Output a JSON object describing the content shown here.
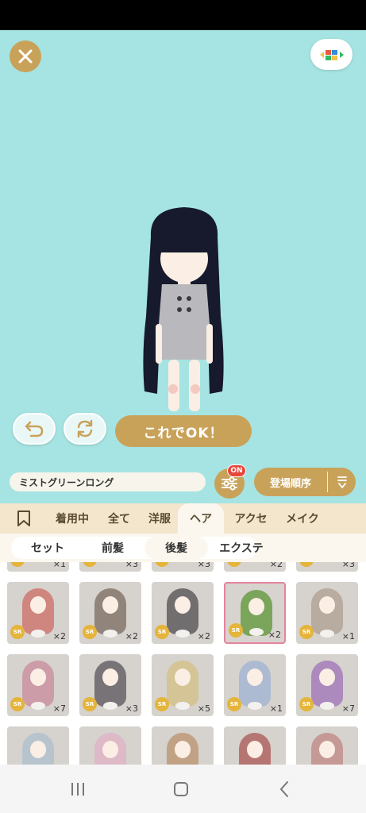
{
  "stage": {
    "ok_label": "これでOK！"
  },
  "namebar": {
    "item_name": "ミストグリーンロング",
    "filter_badge": "ON",
    "sort_label": "登場順序"
  },
  "tabs": [
    {
      "label": "",
      "icon": "bookmark-icon"
    },
    {
      "label": "着用中"
    },
    {
      "label": "全て"
    },
    {
      "label": "洋服"
    },
    {
      "label": "ヘア",
      "active": true
    },
    {
      "label": "アクセ"
    },
    {
      "label": "メイク"
    }
  ],
  "subtabs": [
    {
      "label": "セット"
    },
    {
      "label": "前髪"
    },
    {
      "label": "後髪",
      "active": true
    },
    {
      "label": "エクステ"
    }
  ],
  "grid": {
    "partial_row": [
      "×1",
      "×3",
      "×3",
      "×2",
      "×3"
    ],
    "row1": [
      {
        "rarity": "SR",
        "count": "×2",
        "color": "#c8473f"
      },
      {
        "rarity": "SR",
        "count": "×2",
        "color": "#5a4638"
      },
      {
        "rarity": "SR",
        "count": "×2",
        "color": "#1f1c24"
      },
      {
        "rarity": "SR",
        "count": "×2",
        "color": "#7aa55a",
        "selected": true
      },
      {
        "rarity": "SR",
        "count": "×1",
        "color": "#a08a7a"
      }
    ],
    "row2": [
      {
        "rarity": "SR",
        "count": "×7",
        "color": "#c4708a"
      },
      {
        "rarity": "SR",
        "count": "×3",
        "color": "#2b2530"
      },
      {
        "rarity": "SR",
        "count": "×5",
        "color": "#d4b86a"
      },
      {
        "rarity": "SR",
        "count": "×1",
        "color": "#8aa8d6"
      },
      {
        "rarity": "SR",
        "count": "×7",
        "color": "#8a4fb0"
      }
    ]
  }
}
